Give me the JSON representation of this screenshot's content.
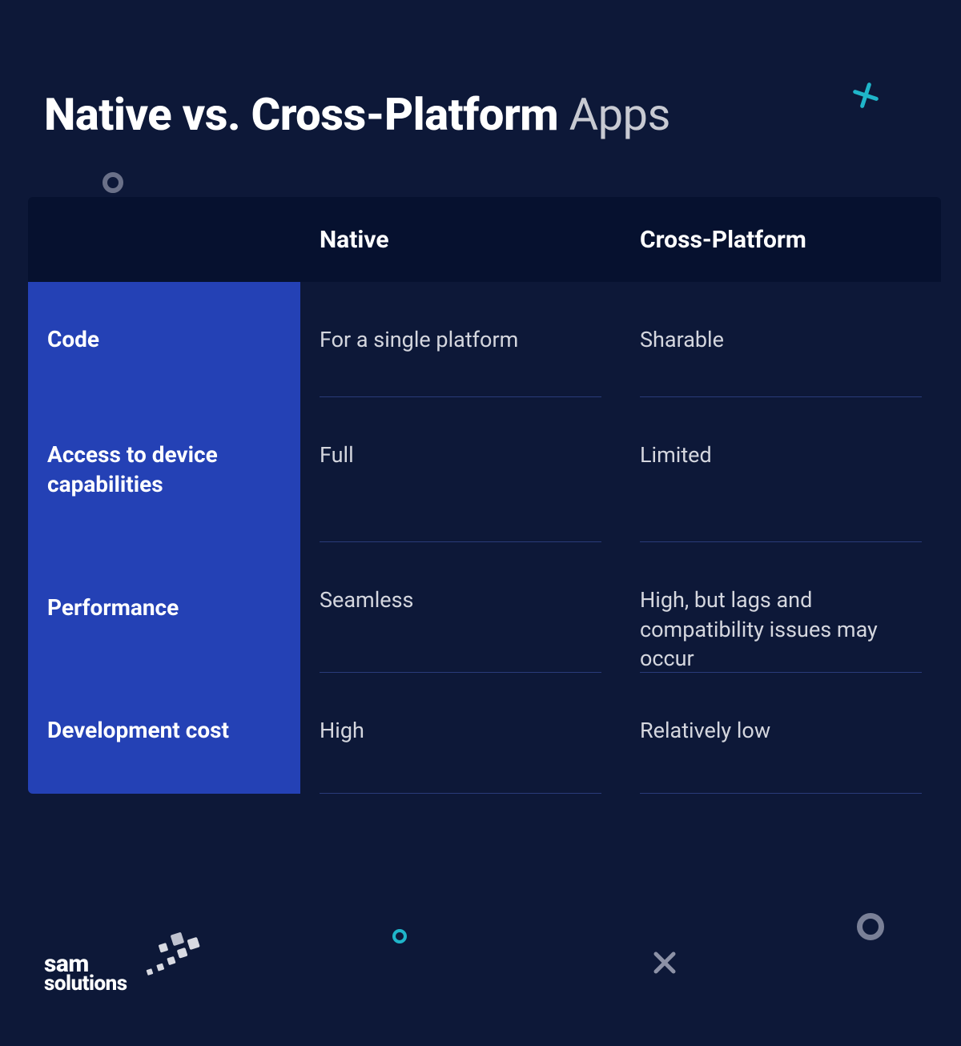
{
  "title": {
    "bold": "Native vs. Cross-Platform",
    "rest": " Apps"
  },
  "table": {
    "headers": [
      "",
      "Native",
      "Cross-Platform"
    ],
    "rows": [
      {
        "label": "Code",
        "native": "For a single platform",
        "cross": "Sharable"
      },
      {
        "label": "Access to device capabilities",
        "native": "Full",
        "cross": "Limited"
      },
      {
        "label": "Performance",
        "native": "Seamless",
        "cross": "High, but lags and compatibility issues may occur"
      },
      {
        "label": "Development cost",
        "native": "High",
        "cross": "Relatively low"
      }
    ]
  },
  "logo": {
    "line1": "sam",
    "line2": "solutions"
  }
}
